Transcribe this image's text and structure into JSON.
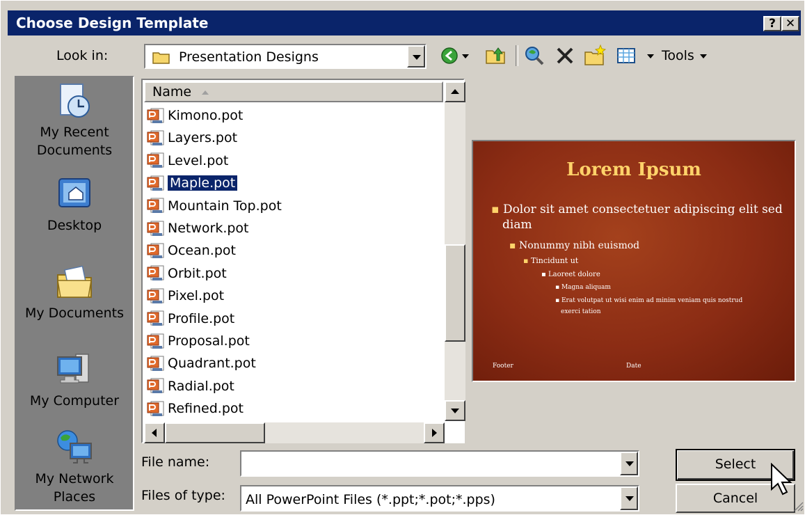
{
  "dialog": {
    "title": "Choose Design Template",
    "help_glyph": "?",
    "close_glyph": "✕"
  },
  "toolbar": {
    "look_in_label": "Look in:",
    "look_in_value": "Presentation Designs",
    "tools_label": "Tools"
  },
  "places": [
    {
      "label": "My Recent Documents",
      "icon": "recent-documents-icon"
    },
    {
      "label": "Desktop",
      "icon": "desktop-icon"
    },
    {
      "label": "My Documents",
      "icon": "my-documents-icon"
    },
    {
      "label": "My Computer",
      "icon": "my-computer-icon"
    },
    {
      "label": "My Network Places",
      "icon": "network-places-icon"
    }
  ],
  "list": {
    "column_name": "Name",
    "files": [
      "Kimono.pot",
      "Layers.pot",
      "Level.pot",
      "Maple.pot",
      "Mountain Top.pot",
      "Network.pot",
      "Ocean.pot",
      "Orbit.pot",
      "Pixel.pot",
      "Profile.pot",
      "Proposal.pot",
      "Quadrant.pot",
      "Radial.pot",
      "Refined.pot"
    ],
    "selected_index": 3
  },
  "preview": {
    "title": "Lorem Ipsum",
    "bullets": [
      "Dolor sit amet consectetuer adipiscing elit sed",
      "diam",
      "Nonummy nibh euismod",
      "Tincidunt ut",
      "Laoreet dolore",
      "Magna aliquam",
      "Erat volutpat ut wisi enim ad minim veniam quis nostrud",
      "exerci tation"
    ],
    "footer_left": "Footer",
    "footer_right": "Date"
  },
  "form": {
    "file_name_label": "File name:",
    "file_name_value": "",
    "files_of_type_label": "Files of type:",
    "files_of_type_value": "All PowerPoint Files (*.ppt;*.pot;*.pps)"
  },
  "buttons": {
    "select": "Select",
    "cancel": "Cancel"
  },
  "colors": {
    "titlebar": "#0a246a",
    "dialog_bg": "#d4d0c8",
    "preview_bg": "#8b2c14",
    "preview_title": "#ffd36a"
  }
}
